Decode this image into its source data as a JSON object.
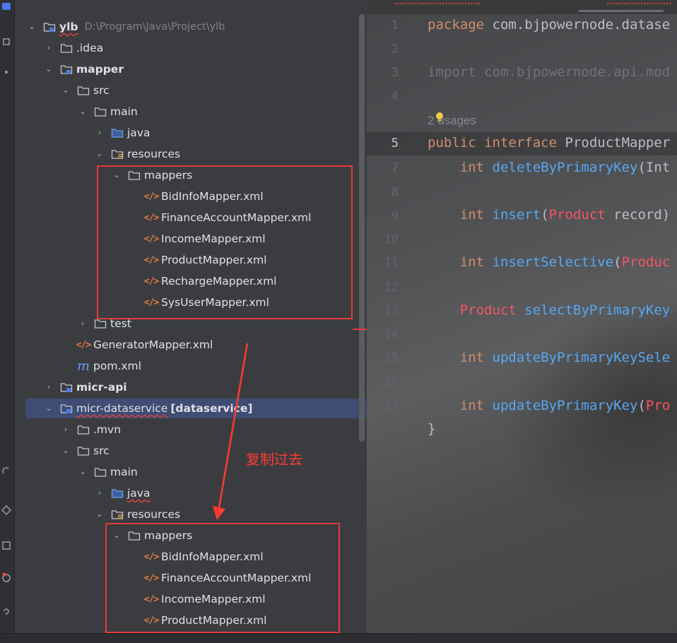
{
  "tree": {
    "root": {
      "label": "ylb",
      "path": "D:\\Program\\Java\\Project\\ylb"
    },
    "idea": ".idea",
    "mapper": "mapper",
    "src1": "src",
    "main1": "main",
    "java1": "java",
    "resources1": "resources",
    "mappers1": "mappers",
    "files1": [
      "BidInfoMapper.xml",
      "FinanceAccountMapper.xml",
      "IncomeMapper.xml",
      "ProductMapper.xml",
      "RechargeMapper.xml",
      "SysUserMapper.xml"
    ],
    "test": "test",
    "generator": "GeneratorMapper.xml",
    "pom": "pom.xml",
    "micr_api": "micr-api",
    "dataservice": {
      "label": "micr-dataservice",
      "tag": "[dataservice]"
    },
    "mvn": ".mvn",
    "src2": "src",
    "main2": "main",
    "java2": "java",
    "resources2": "resources",
    "mappers2": "mappers",
    "files2": [
      "BidInfoMapper.xml",
      "FinanceAccountMapper.xml",
      "IncomeMapper.xml",
      "ProductMapper.xml"
    ]
  },
  "annotation": "复制过去",
  "editor": {
    "line_numbers": [
      "1",
      "2",
      "3",
      "4",
      "",
      "5",
      "7",
      "8",
      "9",
      "10",
      "11",
      "12",
      "13",
      "14",
      "15",
      "16",
      "17"
    ],
    "lines": {
      "l1_kw": "package",
      "l1_rest": " com.bjpowernode.datase",
      "l3_kw": "import",
      "l3_rest": " com.bjpowernode.api.mod",
      "usages": "2 usages",
      "l5_kw1": "public",
      "l5_kw2": "interface",
      "l5_name": "ProductMapper",
      "l7_kw": "int",
      "l7_fn": "deleteByPrimaryKey",
      "l7_rest": "(Int",
      "l9_kw": "int",
      "l9_fn": "insert",
      "l9_p": "(",
      "l9_type": "Product",
      "l9_rest": " record)",
      "l11_kw": "int",
      "l11_fn": "insertSelective",
      "l11_p": "(",
      "l11_type": "Produc",
      "l13_type": "Product",
      "l13_fn": "selectByPrimaryKey",
      "l15_kw": "int",
      "l15_fn": "updateByPrimaryKeySele",
      "l17_kw": "int",
      "l17_fn": "updateByPrimaryKey",
      "l17_p": "(",
      "l17_type": "Pro",
      "close": "}"
    }
  },
  "colors": {
    "highlight_box": "#e53b3b",
    "annotation": "#ff3b30",
    "selection": "#3f4c73"
  }
}
